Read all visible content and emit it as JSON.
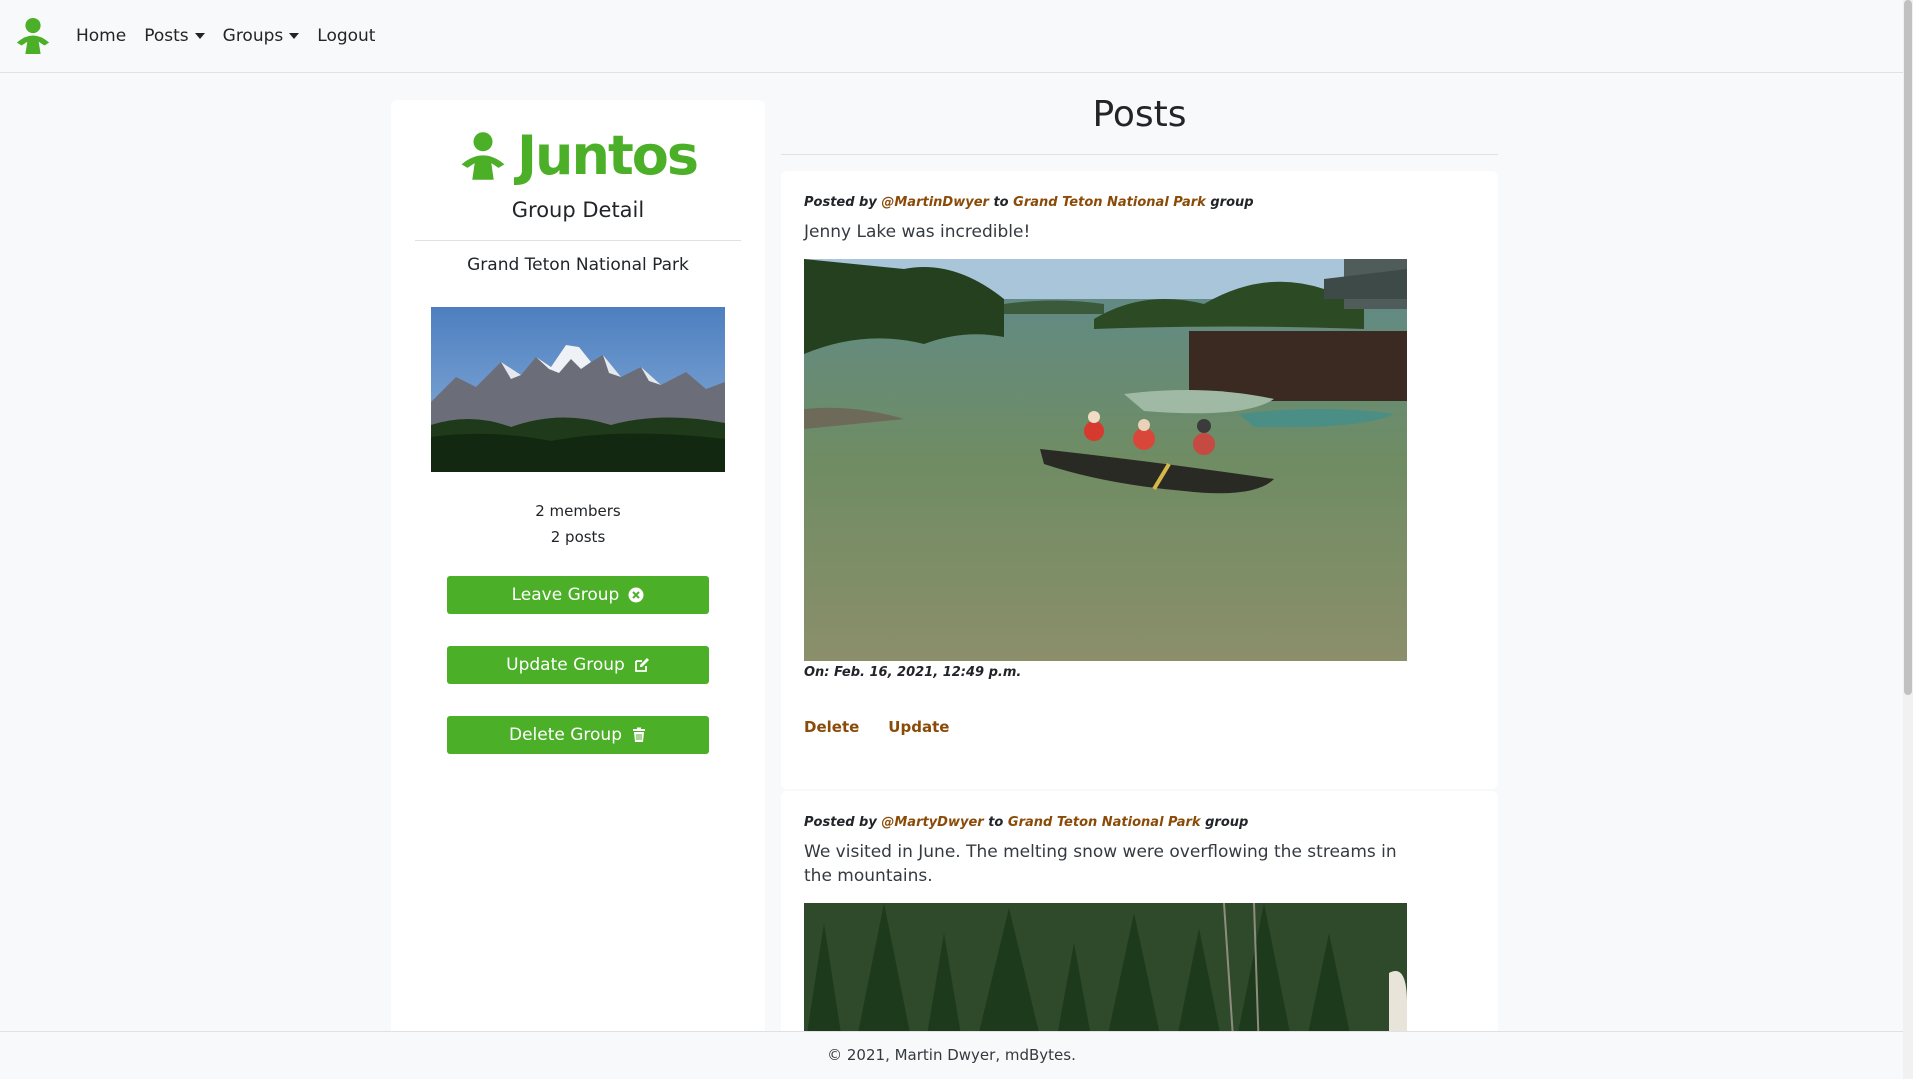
{
  "nav": {
    "items": [
      {
        "label": "Home",
        "dropdown": false
      },
      {
        "label": "Posts",
        "dropdown": true
      },
      {
        "label": "Groups",
        "dropdown": true
      },
      {
        "label": "Logout",
        "dropdown": false
      }
    ]
  },
  "colors": {
    "brand": "#4caf28",
    "link": "#8a4b08"
  },
  "sidebar": {
    "logo_text": "Juntos",
    "subtitle": "Group Detail",
    "group_name": "Grand Teton National Park",
    "members": "2 members",
    "posts": "2 posts",
    "buttons": {
      "leave": "Leave Group",
      "update": "Update Group",
      "delete": "Delete Group"
    }
  },
  "main": {
    "title": "Posts",
    "posts": [
      {
        "posted_by_label": "Posted by",
        "author": "@MartinDwyer",
        "to_label": "to",
        "group": "Grand Teton National Park",
        "group_suffix": "group",
        "text": "Jenny Lake was incredible!",
        "timestamp": "On: Feb. 16, 2021, 12:49 p.m.",
        "delete_label": "Delete",
        "update_label": "Update"
      },
      {
        "posted_by_label": "Posted by",
        "author": "@MartyDwyer",
        "to_label": "to",
        "group": "Grand Teton National Park",
        "group_suffix": "group",
        "text": "We visited in June. The melting snow were overflowing the streams in the mountains."
      }
    ]
  },
  "footer": {
    "text": "© 2021, Martin Dwyer, mdBytes."
  }
}
